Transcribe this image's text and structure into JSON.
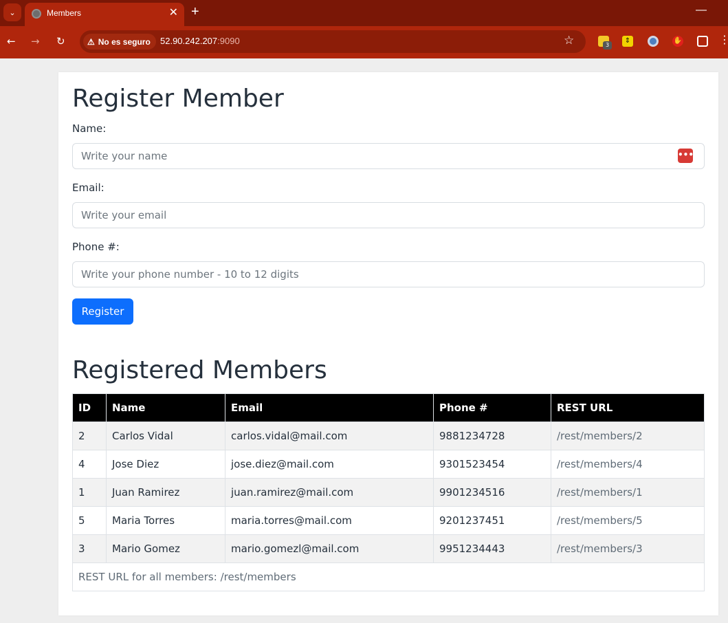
{
  "browser": {
    "tab_title": "Members",
    "new_tab": "+",
    "close": "✕",
    "minimize": "—",
    "not_secure_label": "No es seguro",
    "url_host": "52.90.242.207",
    "url_port": ":9090",
    "extension_badge": "3"
  },
  "register": {
    "heading": "Register Member",
    "name_label": "Name:",
    "name_placeholder": "Write your name",
    "email_label": "Email:",
    "email_placeholder": "Write your email",
    "phone_label": "Phone #:",
    "phone_placeholder": "Write your phone number - 10 to 12 digits",
    "submit_label": "Register"
  },
  "members": {
    "heading": "Registered Members",
    "columns": [
      "ID",
      "Name",
      "Email",
      "Phone #",
      "REST URL"
    ],
    "rows": [
      {
        "id": "2",
        "name": "Carlos Vidal",
        "email": "carlos.vidal@mail.com",
        "phone": "9881234728",
        "url": "/rest/members/2"
      },
      {
        "id": "4",
        "name": "Jose Diez",
        "email": "jose.diez@mail.com",
        "phone": "9301523454",
        "url": "/rest/members/4"
      },
      {
        "id": "1",
        "name": "Juan Ramirez",
        "email": "juan.ramirez@mail.com",
        "phone": "9901234516",
        "url": "/rest/members/1"
      },
      {
        "id": "5",
        "name": "Maria Torres",
        "email": "maria.torres@mail.com",
        "phone": "9201237451",
        "url": "/rest/members/5"
      },
      {
        "id": "3",
        "name": "Mario Gomez",
        "email": "mario.gomezl@mail.com",
        "phone": "9951234443",
        "url": "/rest/members/3"
      }
    ],
    "footer_text": "REST URL for all members: ",
    "footer_link": "/rest/members"
  },
  "colors": {
    "tab_bar": "#7a1706",
    "toolbar": "#b0260c",
    "primary_button": "#0d6efd",
    "table_header": "#000000"
  }
}
